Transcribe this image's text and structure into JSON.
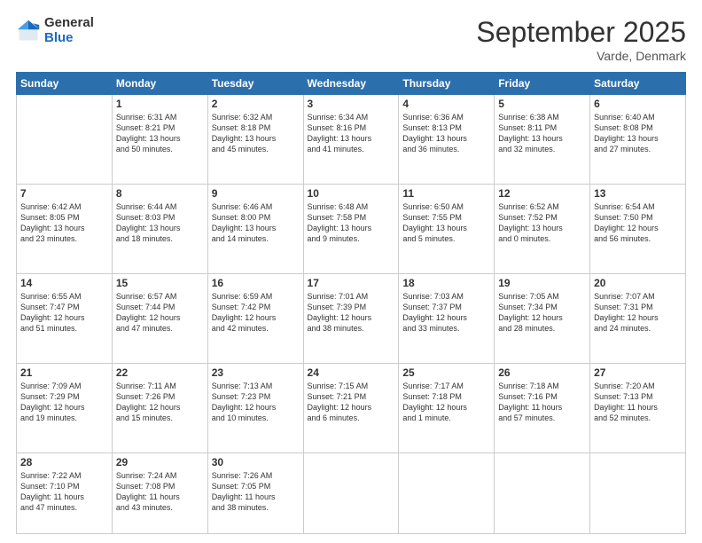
{
  "header": {
    "logo_general": "General",
    "logo_blue": "Blue",
    "month_title": "September 2025",
    "location": "Varde, Denmark"
  },
  "weekdays": [
    "Sunday",
    "Monday",
    "Tuesday",
    "Wednesday",
    "Thursday",
    "Friday",
    "Saturday"
  ],
  "weeks": [
    [
      {
        "day": "",
        "info": ""
      },
      {
        "day": "1",
        "info": "Sunrise: 6:31 AM\nSunset: 8:21 PM\nDaylight: 13 hours\nand 50 minutes."
      },
      {
        "day": "2",
        "info": "Sunrise: 6:32 AM\nSunset: 8:18 PM\nDaylight: 13 hours\nand 45 minutes."
      },
      {
        "day": "3",
        "info": "Sunrise: 6:34 AM\nSunset: 8:16 PM\nDaylight: 13 hours\nand 41 minutes."
      },
      {
        "day": "4",
        "info": "Sunrise: 6:36 AM\nSunset: 8:13 PM\nDaylight: 13 hours\nand 36 minutes."
      },
      {
        "day": "5",
        "info": "Sunrise: 6:38 AM\nSunset: 8:11 PM\nDaylight: 13 hours\nand 32 minutes."
      },
      {
        "day": "6",
        "info": "Sunrise: 6:40 AM\nSunset: 8:08 PM\nDaylight: 13 hours\nand 27 minutes."
      }
    ],
    [
      {
        "day": "7",
        "info": "Sunrise: 6:42 AM\nSunset: 8:05 PM\nDaylight: 13 hours\nand 23 minutes."
      },
      {
        "day": "8",
        "info": "Sunrise: 6:44 AM\nSunset: 8:03 PM\nDaylight: 13 hours\nand 18 minutes."
      },
      {
        "day": "9",
        "info": "Sunrise: 6:46 AM\nSunset: 8:00 PM\nDaylight: 13 hours\nand 14 minutes."
      },
      {
        "day": "10",
        "info": "Sunrise: 6:48 AM\nSunset: 7:58 PM\nDaylight: 13 hours\nand 9 minutes."
      },
      {
        "day": "11",
        "info": "Sunrise: 6:50 AM\nSunset: 7:55 PM\nDaylight: 13 hours\nand 5 minutes."
      },
      {
        "day": "12",
        "info": "Sunrise: 6:52 AM\nSunset: 7:52 PM\nDaylight: 13 hours\nand 0 minutes."
      },
      {
        "day": "13",
        "info": "Sunrise: 6:54 AM\nSunset: 7:50 PM\nDaylight: 12 hours\nand 56 minutes."
      }
    ],
    [
      {
        "day": "14",
        "info": "Sunrise: 6:55 AM\nSunset: 7:47 PM\nDaylight: 12 hours\nand 51 minutes."
      },
      {
        "day": "15",
        "info": "Sunrise: 6:57 AM\nSunset: 7:44 PM\nDaylight: 12 hours\nand 47 minutes."
      },
      {
        "day": "16",
        "info": "Sunrise: 6:59 AM\nSunset: 7:42 PM\nDaylight: 12 hours\nand 42 minutes."
      },
      {
        "day": "17",
        "info": "Sunrise: 7:01 AM\nSunset: 7:39 PM\nDaylight: 12 hours\nand 38 minutes."
      },
      {
        "day": "18",
        "info": "Sunrise: 7:03 AM\nSunset: 7:37 PM\nDaylight: 12 hours\nand 33 minutes."
      },
      {
        "day": "19",
        "info": "Sunrise: 7:05 AM\nSunset: 7:34 PM\nDaylight: 12 hours\nand 28 minutes."
      },
      {
        "day": "20",
        "info": "Sunrise: 7:07 AM\nSunset: 7:31 PM\nDaylight: 12 hours\nand 24 minutes."
      }
    ],
    [
      {
        "day": "21",
        "info": "Sunrise: 7:09 AM\nSunset: 7:29 PM\nDaylight: 12 hours\nand 19 minutes."
      },
      {
        "day": "22",
        "info": "Sunrise: 7:11 AM\nSunset: 7:26 PM\nDaylight: 12 hours\nand 15 minutes."
      },
      {
        "day": "23",
        "info": "Sunrise: 7:13 AM\nSunset: 7:23 PM\nDaylight: 12 hours\nand 10 minutes."
      },
      {
        "day": "24",
        "info": "Sunrise: 7:15 AM\nSunset: 7:21 PM\nDaylight: 12 hours\nand 6 minutes."
      },
      {
        "day": "25",
        "info": "Sunrise: 7:17 AM\nSunset: 7:18 PM\nDaylight: 12 hours\nand 1 minute."
      },
      {
        "day": "26",
        "info": "Sunrise: 7:18 AM\nSunset: 7:16 PM\nDaylight: 11 hours\nand 57 minutes."
      },
      {
        "day": "27",
        "info": "Sunrise: 7:20 AM\nSunset: 7:13 PM\nDaylight: 11 hours\nand 52 minutes."
      }
    ],
    [
      {
        "day": "28",
        "info": "Sunrise: 7:22 AM\nSunset: 7:10 PM\nDaylight: 11 hours\nand 47 minutes."
      },
      {
        "day": "29",
        "info": "Sunrise: 7:24 AM\nSunset: 7:08 PM\nDaylight: 11 hours\nand 43 minutes."
      },
      {
        "day": "30",
        "info": "Sunrise: 7:26 AM\nSunset: 7:05 PM\nDaylight: 11 hours\nand 38 minutes."
      },
      {
        "day": "",
        "info": ""
      },
      {
        "day": "",
        "info": ""
      },
      {
        "day": "",
        "info": ""
      },
      {
        "day": "",
        "info": ""
      }
    ]
  ]
}
